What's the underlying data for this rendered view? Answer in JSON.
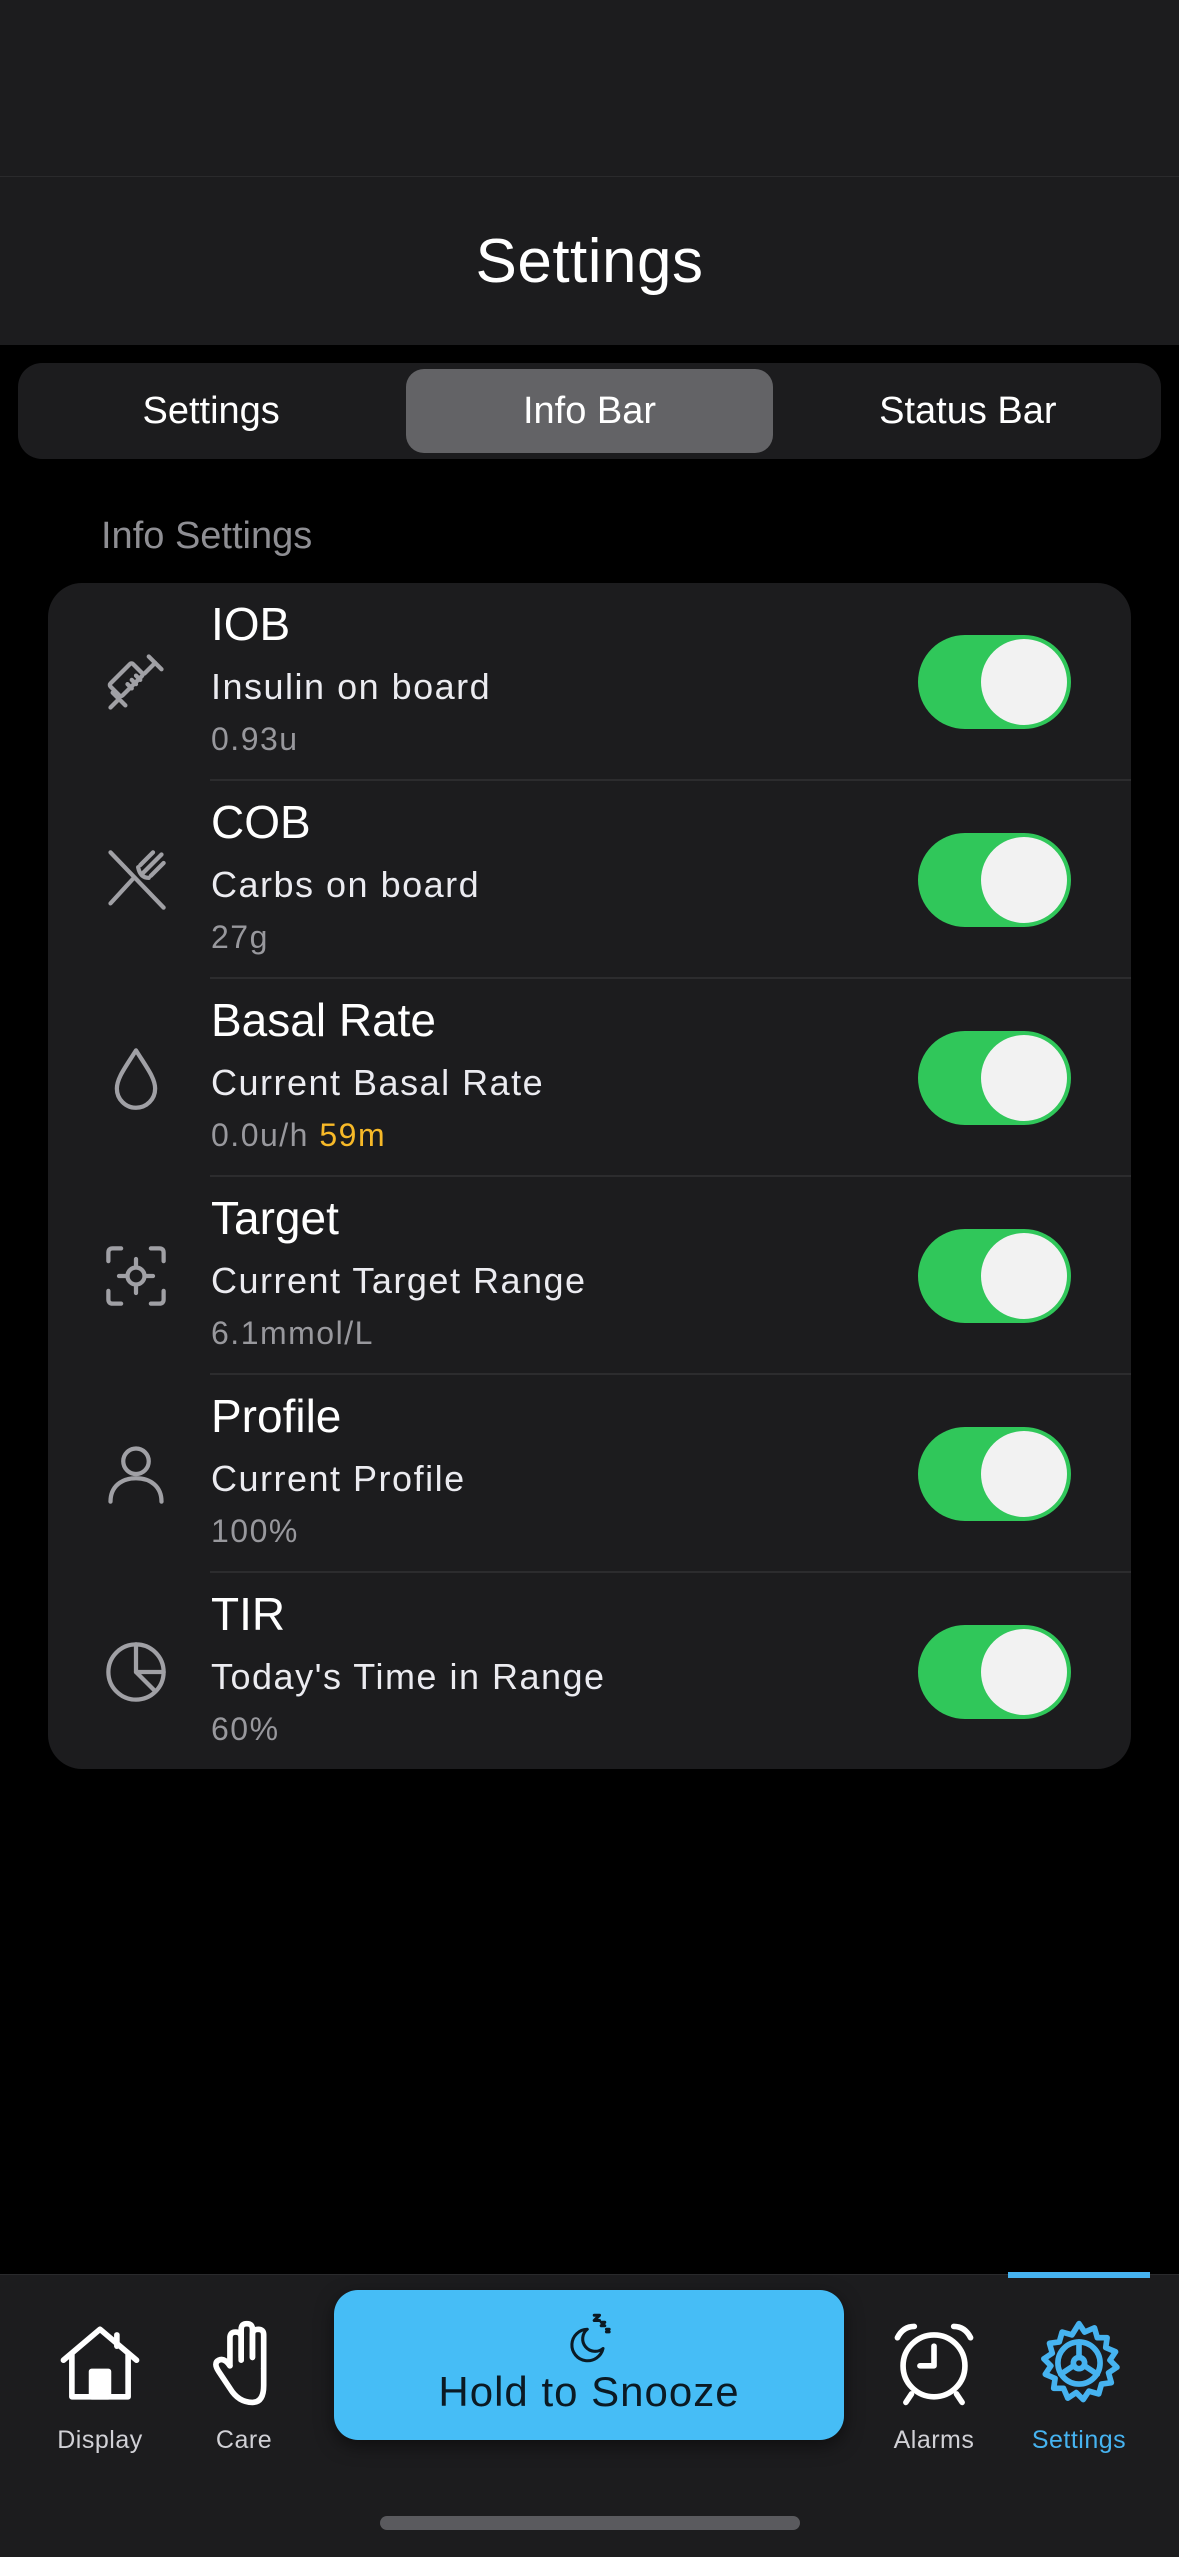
{
  "header": {
    "title": "Settings"
  },
  "segments": [
    {
      "label": "Settings"
    },
    {
      "label": "Info Bar",
      "active": true
    },
    {
      "label": "Status Bar"
    }
  ],
  "section": {
    "title": "Info Settings"
  },
  "rows": [
    {
      "title": "IOB",
      "subtitle": "Insulin on board",
      "value": "0.93u",
      "value_extra": "",
      "enabled": true,
      "icon": "syringe-icon"
    },
    {
      "title": "COB",
      "subtitle": "Carbs on board",
      "value": "27g",
      "value_extra": "",
      "enabled": true,
      "icon": "fork-knife-icon"
    },
    {
      "title": "Basal Rate",
      "subtitle": "Current Basal Rate",
      "value": "0.0u/h",
      "value_extra": "59m",
      "enabled": true,
      "icon": "drop-icon"
    },
    {
      "title": "Target",
      "subtitle": "Current Target Range",
      "value": "6.1mmol/L",
      "value_extra": "",
      "enabled": true,
      "icon": "target-icon"
    },
    {
      "title": "Profile",
      "subtitle": "Current Profile",
      "value": "100%",
      "value_extra": "",
      "enabled": true,
      "icon": "person-icon"
    },
    {
      "title": "TIR",
      "subtitle": "Today's Time in Range",
      "value": "60%",
      "value_extra": "",
      "enabled": true,
      "icon": "pie-chart-icon"
    }
  ],
  "colors": {
    "toggle_on": "#30c75a",
    "accent_orange": "#f7b928",
    "tab_active": "#46b3f0",
    "snooze_bg": "#46bdf6"
  },
  "tabbar": {
    "display": "Display",
    "care": "Care",
    "snooze": "Hold to Snooze",
    "alarms": "Alarms",
    "settings": "Settings"
  }
}
